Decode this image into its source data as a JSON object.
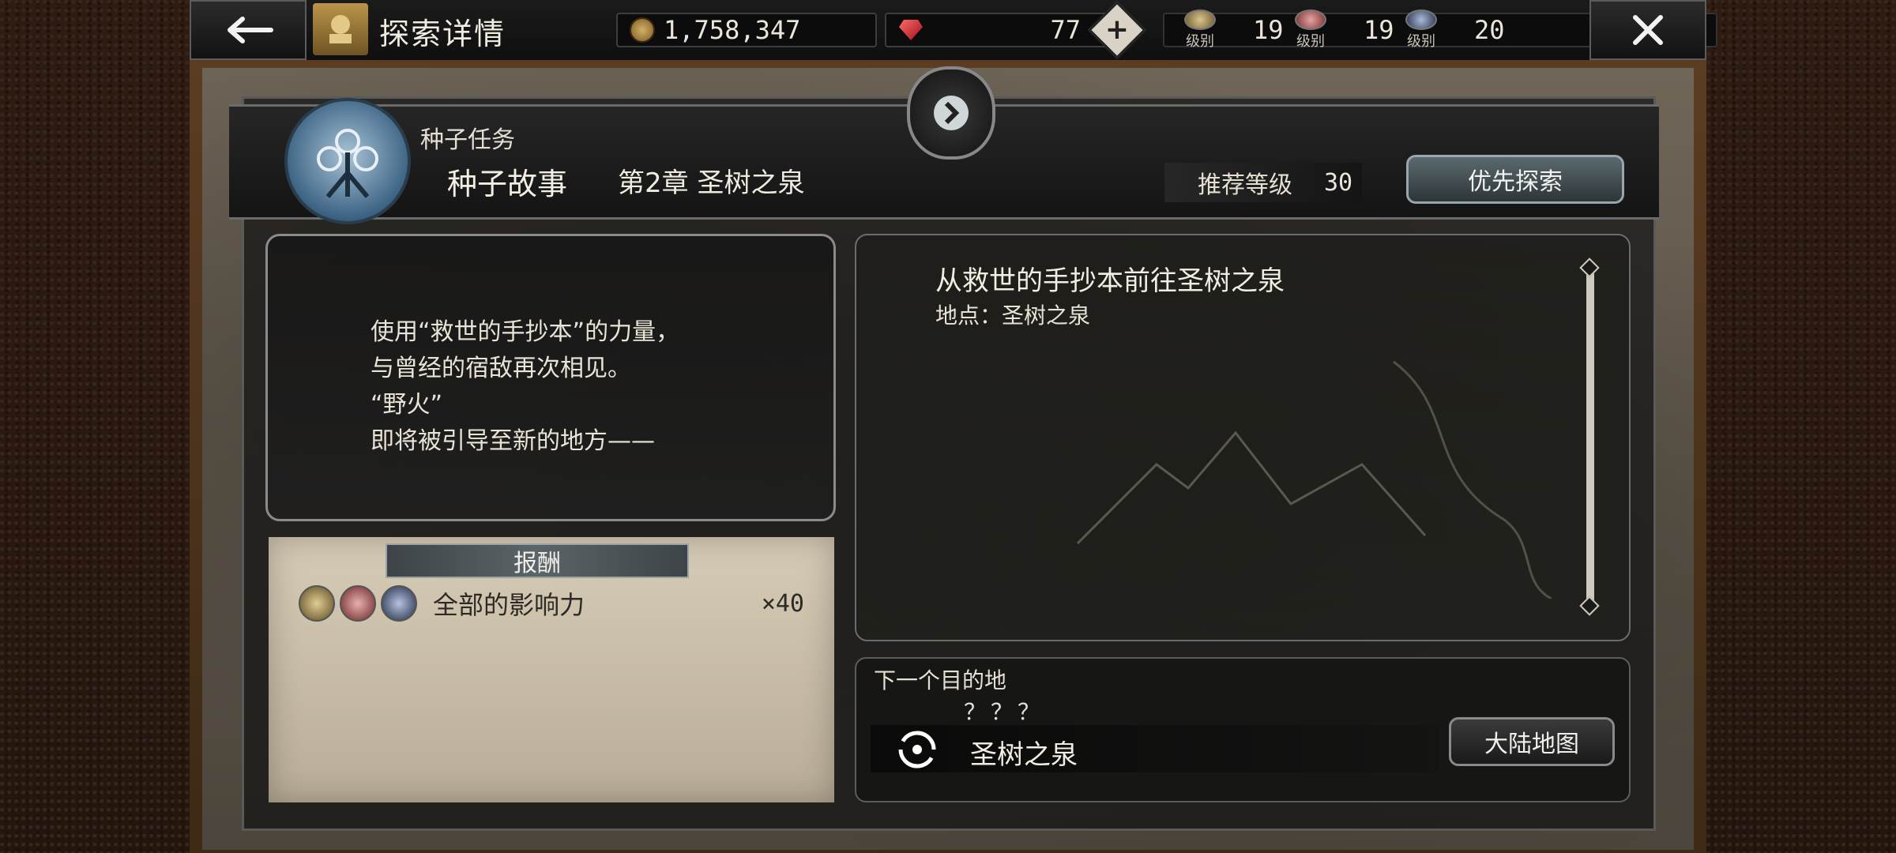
{
  "header": {
    "title": "探索详情",
    "gold": "1,758,347",
    "gems": "77",
    "add_label": "+",
    "levels": [
      {
        "caption": "级别",
        "value": "19"
      },
      {
        "caption": "级别",
        "value": "19"
      },
      {
        "caption": "级别",
        "value": "20"
      }
    ]
  },
  "mission": {
    "type": "种子任务",
    "name": "种子故事",
    "chapter": "第2章  圣树之泉",
    "recommend_label": "推荐等级",
    "recommend_value": "30",
    "priority_button": "优先探索"
  },
  "description": {
    "lines": [
      "使用“救世的手抄本”的力量，",
      "与曾经的宿敌再次相见。",
      "“野火”",
      "即将被引导至新的地方——"
    ]
  },
  "reward": {
    "header": "报酬",
    "item": "全部的影响力",
    "quantity": "×40"
  },
  "objective": {
    "title": "从救世的手抄本前往圣树之泉",
    "location": "地点：圣树之泉"
  },
  "next": {
    "label": "下一个目的地",
    "unknown": "？？？",
    "place": "圣树之泉",
    "map_button": "大陆地图"
  },
  "icons": {
    "back": "back-arrow-icon",
    "close": "close-icon",
    "coin": "coin-icon",
    "gem": "gem-icon"
  },
  "colors": {
    "accent_gold": "#b9954a",
    "parchment": "#d6cbb6",
    "seed_blue": "#3d6484"
  }
}
